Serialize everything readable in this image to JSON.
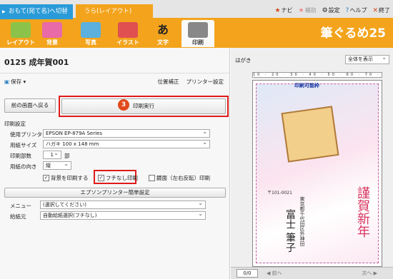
{
  "tabs": {
    "front": "おもて(宛て名)へ切替",
    "back": "うら(レイアウト)"
  },
  "topmenu": [
    {
      "icon": "★",
      "label": "ナビ"
    },
    {
      "icon": "★",
      "label": "補助"
    },
    {
      "icon": "⚙",
      "label": "設定"
    },
    {
      "icon": "?",
      "label": "ヘルプ"
    },
    {
      "icon": "✕",
      "label": "終了"
    }
  ],
  "toolbar": [
    "レイアウト",
    "背景",
    "写真",
    "イラスト",
    "文字",
    "印刷"
  ],
  "logo": "筆ぐるめ25",
  "panel": {
    "title": "0125 成年賀001",
    "save": "保存",
    "position": "位置補正",
    "printer_settings": "プリンター設定",
    "back_button": "前の画面へ戻る",
    "print_button": "印刷実行",
    "step": "3"
  },
  "settings": {
    "section": "印刷設定",
    "printer_label": "使用プリンター",
    "printer": "EPSON EP-879A Series",
    "size_label": "用紙サイズ",
    "size": "ハガキ 100 x 148 mm",
    "copies_label": "印刷部数",
    "copies": "1",
    "copies_unit": "部",
    "orientation_label": "用紙の向き",
    "orientation": "縦",
    "bg_print": "背景を印刷する",
    "borderless": "フチなし印刷",
    "mirror": "鏡面（左右反転）印刷",
    "epson_section": "エプソンプリンター簡単設定",
    "menu_label": "メニュー",
    "menu_value": "(選択してください)",
    "feed_label": "給紙元",
    "feed_value": "自動給紙選択(フチなし)"
  },
  "preview": {
    "label": "はがき",
    "zoom": "全体を表示",
    "ruler": "10 · 20 · 30 · 40 · 50 · 60 · 70 · 80 · 90",
    "printable": "印刷可能枠",
    "greeting": "謹賀新年",
    "name": "富士 筆子",
    "postal": "〒101-0021",
    "address": "東京都千代田区外神田",
    "page": "0/0",
    "prev": "前へ",
    "next": "次へ"
  }
}
